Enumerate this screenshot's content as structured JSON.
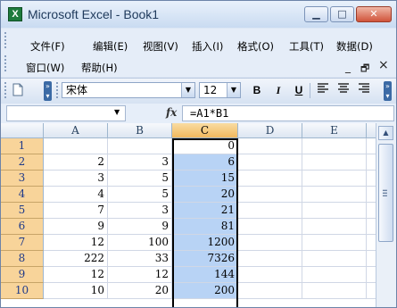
{
  "window": {
    "title": "Microsoft Excel - Book1",
    "app_icon": "X",
    "minimize_icon": "minimize-icon",
    "maximize_icon": "maximize-icon",
    "close_icon": "close-icon"
  },
  "menu": {
    "items": [
      "文件(F)",
      "编辑(E)",
      "视图(V)",
      "插入(I)",
      "格式(O)",
      "工具(T)",
      "数据(D)",
      "窗口(W)",
      "帮助(H)"
    ],
    "mdi_minimize": "_",
    "mdi_restore": "🗗",
    "mdi_close": "×"
  },
  "toolbar": {
    "font_name": "宋体",
    "font_size": "12",
    "bold": "B",
    "italic": "I",
    "underline": "U"
  },
  "formula_bar": {
    "name_box": "",
    "fx": "fx",
    "formula": "=A1*B1"
  },
  "sheet": {
    "columns": [
      "A",
      "B",
      "C",
      "D",
      "E"
    ],
    "selected_column": "C",
    "rows": [
      {
        "num": "1",
        "a": "",
        "b": "",
        "c": "0"
      },
      {
        "num": "2",
        "a": "2",
        "b": "3",
        "c": "6"
      },
      {
        "num": "3",
        "a": "3",
        "b": "5",
        "c": "15"
      },
      {
        "num": "4",
        "a": "4",
        "b": "5",
        "c": "20"
      },
      {
        "num": "5",
        "a": "7",
        "b": "3",
        "c": "21"
      },
      {
        "num": "6",
        "a": "9",
        "b": "9",
        "c": "81"
      },
      {
        "num": "7",
        "a": "12",
        "b": "100",
        "c": "1200"
      },
      {
        "num": "8",
        "a": "222",
        "b": "33",
        "c": "7326"
      },
      {
        "num": "9",
        "a": "12",
        "b": "12",
        "c": "144"
      },
      {
        "num": "10",
        "a": "10",
        "b": "20",
        "c": "200"
      }
    ]
  }
}
